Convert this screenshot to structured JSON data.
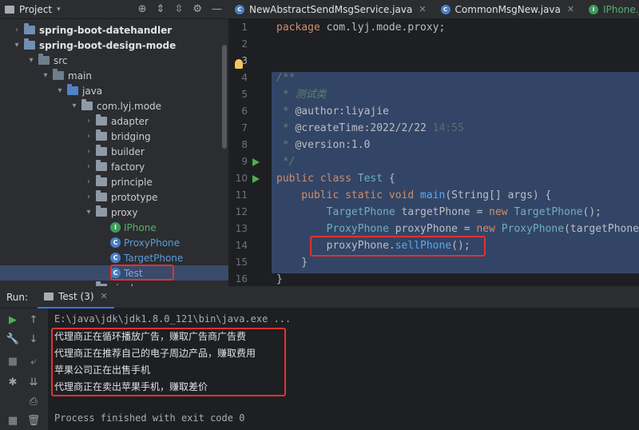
{
  "project": {
    "title": "Project",
    "tree": [
      {
        "label": "spring-boot-datehandler",
        "kind": "module",
        "depth": 1,
        "expanded": false,
        "bold": true
      },
      {
        "label": "spring-boot-design-mode",
        "kind": "module",
        "depth": 1,
        "expanded": true,
        "bold": true
      },
      {
        "label": "src",
        "kind": "src",
        "depth": 2,
        "expanded": true
      },
      {
        "label": "main",
        "kind": "src",
        "depth": 3,
        "expanded": true
      },
      {
        "label": "java",
        "kind": "java",
        "depth": 4,
        "expanded": true
      },
      {
        "label": "com.lyj.mode",
        "kind": "pkg",
        "depth": 5,
        "expanded": true
      },
      {
        "label": "adapter",
        "kind": "pkg",
        "depth": 6,
        "expanded": false
      },
      {
        "label": "bridging",
        "kind": "pkg",
        "depth": 6,
        "expanded": false
      },
      {
        "label": "builder",
        "kind": "pkg",
        "depth": 6,
        "expanded": false
      },
      {
        "label": "factory",
        "kind": "pkg",
        "depth": 6,
        "expanded": false
      },
      {
        "label": "principle",
        "kind": "pkg",
        "depth": 6,
        "expanded": false
      },
      {
        "label": "prototype",
        "kind": "pkg",
        "depth": 6,
        "expanded": false
      },
      {
        "label": "proxy",
        "kind": "pkg",
        "depth": 6,
        "expanded": true
      },
      {
        "label": "IPhone",
        "kind": "interface",
        "depth": 7
      },
      {
        "label": "ProxyPhone",
        "kind": "class",
        "depth": 7
      },
      {
        "label": "TargetPhone",
        "kind": "class",
        "depth": 7
      },
      {
        "label": "Test",
        "kind": "class",
        "depth": 7,
        "selected": true
      },
      {
        "label": "single",
        "kind": "pkg",
        "depth": 6,
        "expanded": false
      }
    ]
  },
  "editor": {
    "tabs": [
      {
        "label": "NewAbstractSendMsgService.java",
        "icon": "class-icon"
      },
      {
        "label": "CommonMsgNew.java",
        "icon": "class-icon"
      },
      {
        "label": "IPhone.java",
        "icon": "interface-icon"
      }
    ],
    "line_numbers": [
      "1",
      "2",
      "3",
      "4",
      "5",
      "6",
      "7",
      "8",
      "9",
      "10",
      "11",
      "12",
      "13",
      "14",
      "15",
      "16"
    ],
    "code": {
      "l1_kw": "package",
      "l1_rest": " com.lyj.mode.proxy;",
      "l3": "/**",
      "l4": " * 测试类",
      "l5_star": " * ",
      "l5_tag": "@author",
      "l5_val": ":liyajie",
      "l6_star": " * ",
      "l6_tag": "@createTime",
      "l6_val": ":2022/2/22 ",
      "l6_time": "14:55",
      "l7_star": " * ",
      "l7_tag": "@version",
      "l7_val": ":1.0",
      "l8": " */",
      "l9_kw": "public class ",
      "l9_type": "Test",
      "l9_rest": " {",
      "l10_kw": "    public static void ",
      "l10_method": "main",
      "l10_rest": "(String[] args) {",
      "l11_indent": "        ",
      "l11_type": "TargetPhone",
      "l11_var": " targetPhone = ",
      "l11_kw": "new ",
      "l11_type2": "TargetPhone",
      "l11_end": "();",
      "l12_indent": "        ",
      "l12_type": "ProxyPhone",
      "l12_var": " proxyPhone = ",
      "l12_kw": "new ",
      "l12_type2": "ProxyPhone",
      "l12_end": "(targetPhone);",
      "l13_indent": "        ",
      "l13_obj": "proxyPhone.",
      "l13_call": "sellPhone",
      "l13_end": "();",
      "l14": "    }",
      "l15": "}"
    }
  },
  "run": {
    "label": "Run:",
    "tab_label": "Test (3)",
    "console": {
      "command": "E:\\java\\jdk\\jdk1.8.0_121\\bin\\java.exe ...",
      "output": [
        "代理商正在循环播放广告，赚取广告商广告费",
        "代理商正在推荐自己的电子周边产品，赚取费用",
        "苹果公司正在出售手机",
        "代理商正在卖出苹果手机，赚取差价"
      ],
      "exit": "Process finished with exit code 0"
    }
  },
  "colors": {
    "highlight": "#e53030",
    "selection": "#324566",
    "accent": "#3574f0"
  }
}
